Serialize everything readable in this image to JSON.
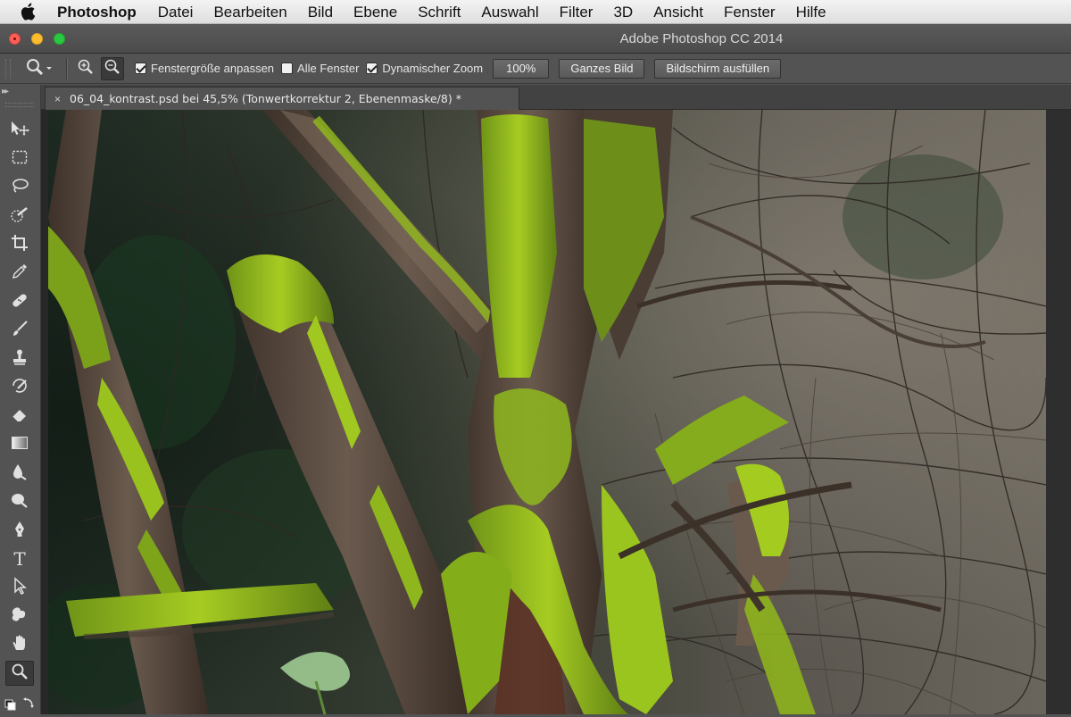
{
  "menubar": {
    "app_name": "Photoshop",
    "items": [
      "Datei",
      "Bearbeiten",
      "Bild",
      "Ebene",
      "Schrift",
      "Auswahl",
      "Filter",
      "3D",
      "Ansicht",
      "Fenster",
      "Hilfe"
    ]
  },
  "window": {
    "title": "Adobe Photoshop CC 2014"
  },
  "options": {
    "resize_windows_label": "Fenstergröße anpassen",
    "resize_windows_checked": true,
    "all_windows_label": "Alle Fenster",
    "all_windows_checked": false,
    "scrubby_zoom_label": "Dynamischer Zoom",
    "scrubby_zoom_checked": true,
    "zoom_100_label": "100%",
    "fit_screen_label": "Ganzes Bild",
    "fill_screen_label": "Bildschirm ausfüllen"
  },
  "document": {
    "tab_label": "06_04_kontrast.psd bei 45,5% (Tonwertkorrektur 2, Ebenenmaske/8) *",
    "close_glyph": "×"
  },
  "tools": [
    {
      "name": "move-tool",
      "active": false
    },
    {
      "name": "marquee-tool",
      "active": false
    },
    {
      "name": "lasso-tool",
      "active": false
    },
    {
      "name": "quick-selection-tool",
      "active": false
    },
    {
      "name": "crop-tool",
      "active": false
    },
    {
      "name": "eyedropper-tool",
      "active": false
    },
    {
      "name": "healing-brush-tool",
      "active": false
    },
    {
      "name": "brush-tool",
      "active": false
    },
    {
      "name": "clone-stamp-tool",
      "active": false
    },
    {
      "name": "history-brush-tool",
      "active": false
    },
    {
      "name": "eraser-tool",
      "active": false
    },
    {
      "name": "gradient-tool",
      "active": false
    },
    {
      "name": "blur-tool",
      "active": false
    },
    {
      "name": "dodge-tool",
      "active": false
    },
    {
      "name": "pen-tool",
      "active": false
    },
    {
      "name": "type-tool",
      "active": false
    },
    {
      "name": "path-selection-tool",
      "active": false
    },
    {
      "name": "custom-shape-tool",
      "active": false
    },
    {
      "name": "hand-tool",
      "active": false
    },
    {
      "name": "zoom-tool",
      "active": true
    }
  ],
  "type_tool_glyph": "T",
  "colors": {
    "ui_background": "#535353",
    "canvas_bg": "#282828",
    "moss_green": "#9bc21d",
    "bark_brown": "#5b4a3e"
  }
}
